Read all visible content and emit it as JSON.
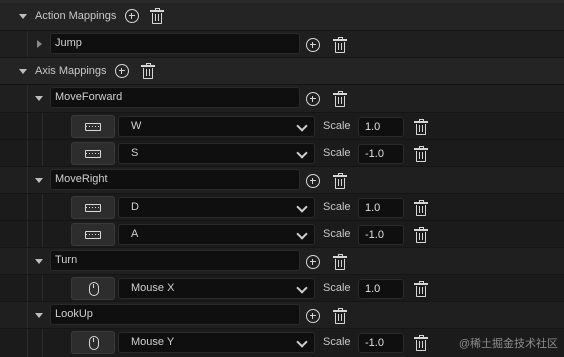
{
  "sections": {
    "action": {
      "label": "Action Mappings"
    },
    "axis": {
      "label": "Axis Mappings"
    }
  },
  "action_mappings": [
    {
      "name": "Jump"
    }
  ],
  "axis_mappings": [
    {
      "name": "MoveForward",
      "keys": [
        {
          "device": "keyboard-icon",
          "key": "W",
          "scale": "1.0"
        },
        {
          "device": "keyboard-icon",
          "key": "S",
          "scale": "-1.0"
        }
      ]
    },
    {
      "name": "MoveRight",
      "keys": [
        {
          "device": "keyboard-icon",
          "key": "D",
          "scale": "1.0"
        },
        {
          "device": "keyboard-icon",
          "key": "A",
          "scale": "-1.0"
        }
      ]
    },
    {
      "name": "Turn",
      "keys": [
        {
          "device": "mouse-icon",
          "key": "Mouse X",
          "scale": "1.0"
        }
      ]
    },
    {
      "name": "LookUp",
      "keys": [
        {
          "device": "mouse-icon",
          "key": "Mouse Y",
          "scale": "-1.0"
        }
      ]
    }
  ],
  "scale_label": "Scale",
  "watermark": "@稀土掘金技术社区"
}
